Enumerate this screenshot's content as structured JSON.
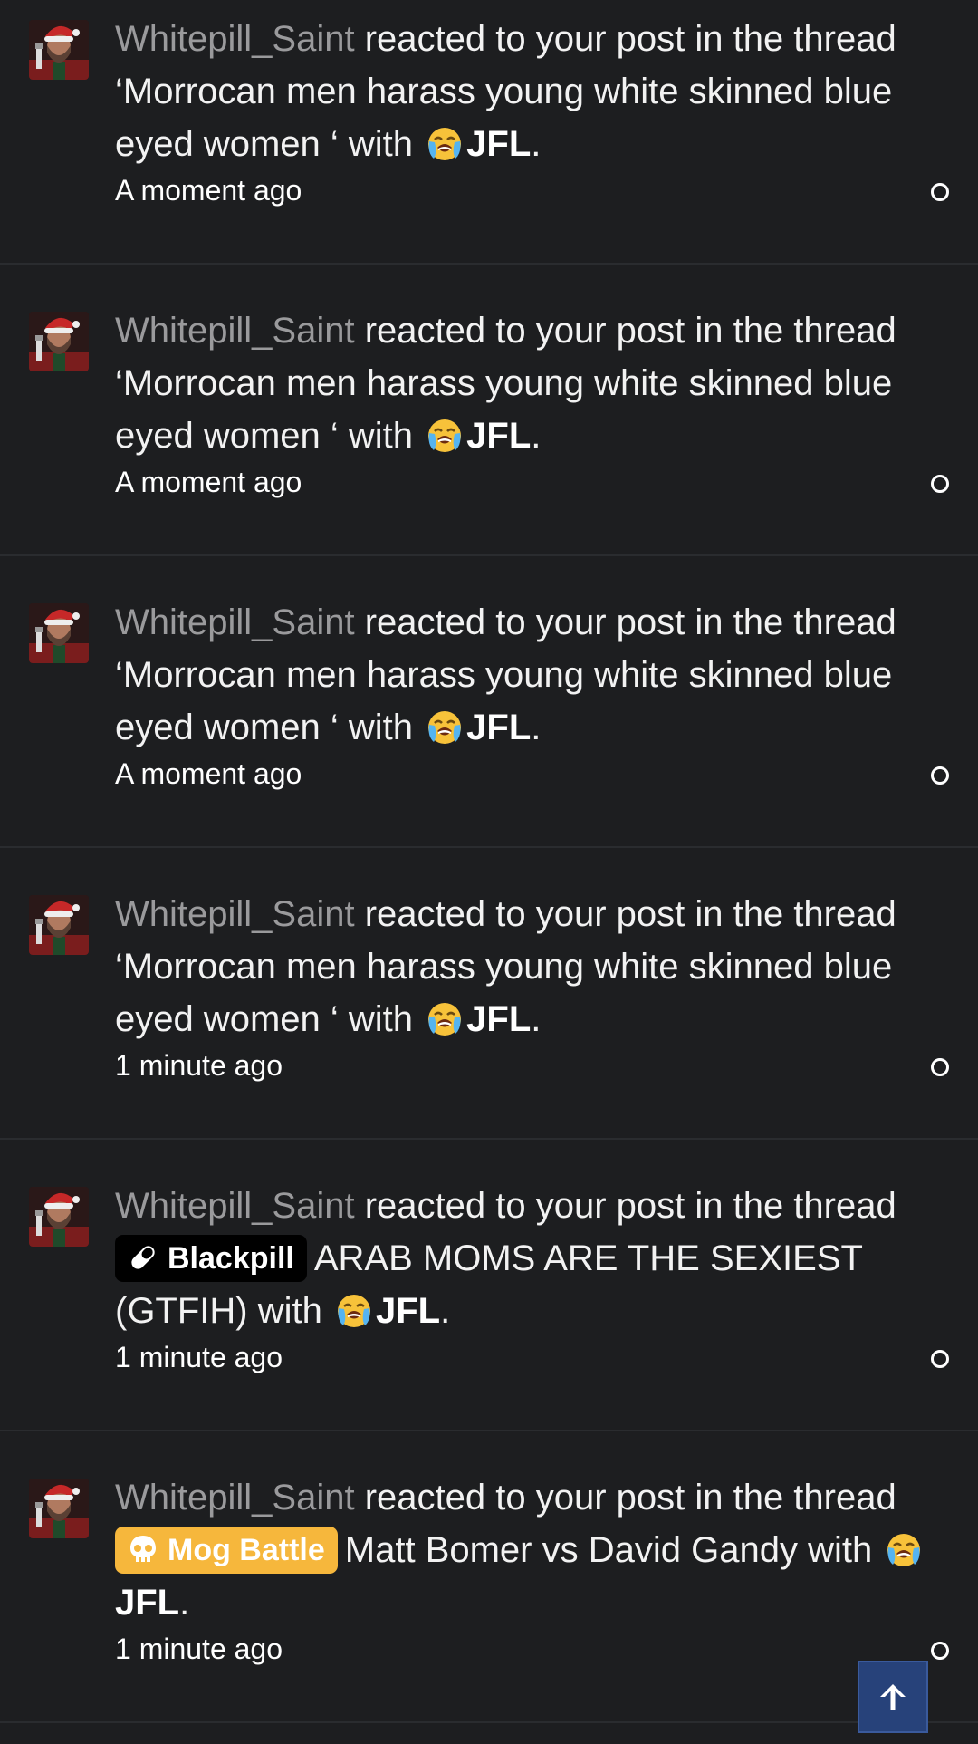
{
  "notifications": [
    {
      "username": "Whitepill_Saint",
      "action": " reacted to your post in the thread ",
      "prefix": "",
      "prefix_style": "",
      "thread": "‘Morrocan men harass young white skinned blue eyed women ‘",
      "with_text": " with ",
      "reaction": "JFL",
      "tail": ".",
      "time": "A moment ago"
    },
    {
      "username": "Whitepill_Saint",
      "action": " reacted to your post in the thread ",
      "prefix": "",
      "prefix_style": "",
      "thread": "‘Morrocan men harass young white skinned blue eyed women ‘",
      "with_text": " with ",
      "reaction": "JFL",
      "tail": ".",
      "time": "A moment ago"
    },
    {
      "username": "Whitepill_Saint",
      "action": " reacted to your post in the thread ",
      "prefix": "",
      "prefix_style": "",
      "thread": "‘Morrocan men harass young white skinned blue eyed women ‘",
      "with_text": " with ",
      "reaction": "JFL",
      "tail": ".",
      "time": "A moment ago"
    },
    {
      "username": "Whitepill_Saint",
      "action": " reacted to your post in the thread ",
      "prefix": "",
      "prefix_style": "",
      "thread": "‘Morrocan men harass young white skinned blue eyed women ‘",
      "with_text": " with ",
      "reaction": "JFL",
      "tail": ".",
      "time": "1 minute ago"
    },
    {
      "username": "Whitepill_Saint",
      "action": " reacted to your post in the thread ",
      "prefix": "Blackpill",
      "prefix_style": "blackpill",
      "thread": "ARAB MOMS ARE THE SEXIEST (GTFIH)",
      "with_text": " with ",
      "reaction": "JFL",
      "tail": ".",
      "time": "1 minute ago"
    },
    {
      "username": "Whitepill_Saint",
      "action": " reacted to your post in the thread ",
      "prefix": "Mog Battle",
      "prefix_style": "mog",
      "thread": "Matt Bomer vs David Gandy",
      "with_text": " with ",
      "reaction": "JFL",
      "tail": ".",
      "time": "1 minute ago"
    }
  ],
  "icons": {
    "avatar": "santa-hat-man-avatar",
    "reaction_emoji": "loudly-crying-face-emoji",
    "mark_read": "circle-outline-icon",
    "scroll_top": "arrow-up-icon",
    "blackpill_prefix": "pill-icon",
    "mog_prefix": "skull-icon"
  },
  "colors": {
    "background": "#1d1e20",
    "username": "#9a9a9c",
    "text": "#f2f2f2",
    "blackpill_badge": "#000000",
    "mog_badge": "#f6b73c",
    "scroll_top_button": "#27427a"
  }
}
